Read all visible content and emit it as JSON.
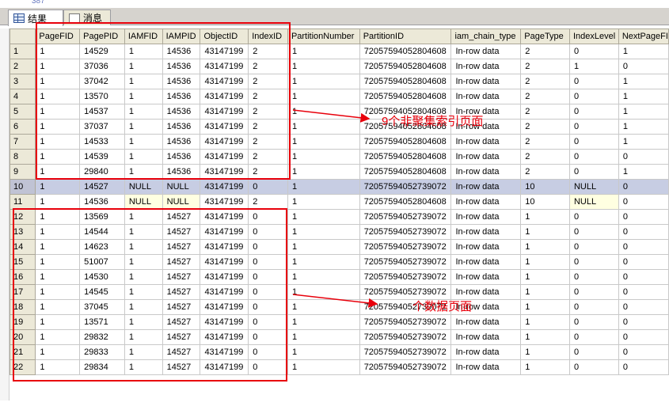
{
  "top_partial_text": "387",
  "tabs": [
    {
      "label": "结果",
      "icon": "results-grid-icon",
      "active": true
    },
    {
      "label": "消息",
      "icon": "messages-icon",
      "active": false
    }
  ],
  "columns": [
    "PageFID",
    "PagePID",
    "IAMFID",
    "IAMPID",
    "ObjectID",
    "IndexID",
    "PartitionNumber",
    "PartitionID",
    "iam_chain_type",
    "PageType",
    "IndexLevel",
    "NextPageFI"
  ],
  "rows": [
    [
      "1",
      "1",
      "14529",
      "1",
      "14536",
      "43147199",
      "2",
      "1",
      "72057594052804608",
      "In-row data",
      "2",
      "0",
      "1"
    ],
    [
      "2",
      "1",
      "37036",
      "1",
      "14536",
      "43147199",
      "2",
      "1",
      "72057594052804608",
      "In-row data",
      "2",
      "1",
      "0"
    ],
    [
      "3",
      "1",
      "37042",
      "1",
      "14536",
      "43147199",
      "2",
      "1",
      "72057594052804608",
      "In-row data",
      "2",
      "0",
      "1"
    ],
    [
      "4",
      "1",
      "13570",
      "1",
      "14536",
      "43147199",
      "2",
      "1",
      "72057594052804608",
      "In-row data",
      "2",
      "0",
      "1"
    ],
    [
      "5",
      "1",
      "14537",
      "1",
      "14536",
      "43147199",
      "2",
      "1",
      "72057594052804608",
      "In-row data",
      "2",
      "0",
      "1"
    ],
    [
      "6",
      "1",
      "37037",
      "1",
      "14536",
      "43147199",
      "2",
      "1",
      "72057594052804608",
      "In-row data",
      "2",
      "0",
      "1"
    ],
    [
      "7",
      "1",
      "14533",
      "1",
      "14536",
      "43147199",
      "2",
      "1",
      "72057594052804608",
      "In-row data",
      "2",
      "0",
      "1"
    ],
    [
      "8",
      "1",
      "14539",
      "1",
      "14536",
      "43147199",
      "2",
      "1",
      "72057594052804608",
      "In-row data",
      "2",
      "0",
      "0"
    ],
    [
      "9",
      "1",
      "29840",
      "1",
      "14536",
      "43147199",
      "2",
      "1",
      "72057594052804608",
      "In-row data",
      "2",
      "0",
      "1"
    ],
    [
      "10",
      "1",
      "14527",
      "NULL",
      "NULL",
      "43147199",
      "0",
      "1",
      "72057594052739072",
      "In-row data",
      "10",
      "NULL",
      "0"
    ],
    [
      "11",
      "1",
      "14536",
      "NULL",
      "NULL",
      "43147199",
      "2",
      "1",
      "72057594052804608",
      "In-row data",
      "10",
      "NULL",
      "0"
    ],
    [
      "12",
      "1",
      "13569",
      "1",
      "14527",
      "43147199",
      "0",
      "1",
      "72057594052739072",
      "In-row data",
      "1",
      "0",
      "0"
    ],
    [
      "13",
      "1",
      "14544",
      "1",
      "14527",
      "43147199",
      "0",
      "1",
      "72057594052739072",
      "In-row data",
      "1",
      "0",
      "0"
    ],
    [
      "14",
      "1",
      "14623",
      "1",
      "14527",
      "43147199",
      "0",
      "1",
      "72057594052739072",
      "In-row data",
      "1",
      "0",
      "0"
    ],
    [
      "15",
      "1",
      "51007",
      "1",
      "14527",
      "43147199",
      "0",
      "1",
      "72057594052739072",
      "In-row data",
      "1",
      "0",
      "0"
    ],
    [
      "16",
      "1",
      "14530",
      "1",
      "14527",
      "43147199",
      "0",
      "1",
      "72057594052739072",
      "In-row data",
      "1",
      "0",
      "0"
    ],
    [
      "17",
      "1",
      "14545",
      "1",
      "14527",
      "43147199",
      "0",
      "1",
      "72057594052739072",
      "In-row data",
      "1",
      "0",
      "0"
    ],
    [
      "18",
      "1",
      "37045",
      "1",
      "14527",
      "43147199",
      "0",
      "1",
      "72057594052739072",
      "In-row data",
      "1",
      "0",
      "0"
    ],
    [
      "19",
      "1",
      "13571",
      "1",
      "14527",
      "43147199",
      "0",
      "1",
      "72057594052739072",
      "In-row data",
      "1",
      "0",
      "0"
    ],
    [
      "20",
      "1",
      "29832",
      "1",
      "14527",
      "43147199",
      "0",
      "1",
      "72057594052739072",
      "In-row data",
      "1",
      "0",
      "0"
    ],
    [
      "21",
      "1",
      "29833",
      "1",
      "14527",
      "43147199",
      "0",
      "1",
      "72057594052739072",
      "In-row data",
      "1",
      "0",
      "0"
    ],
    [
      "22",
      "1",
      "29834",
      "1",
      "14527",
      "43147199",
      "0",
      "1",
      "72057594052739072",
      "In-row data",
      "1",
      "0",
      "0"
    ]
  ],
  "selected_row": 10,
  "annotations": {
    "nonclustered_label": "9个非聚集索引页面",
    "data_label": "个数据页面"
  },
  "colors": {
    "annotation_red": "#e8000b",
    "selected_row": "#c7cde3",
    "header_bg": "#ece9d8",
    "null_cell": "#ffffe1"
  }
}
